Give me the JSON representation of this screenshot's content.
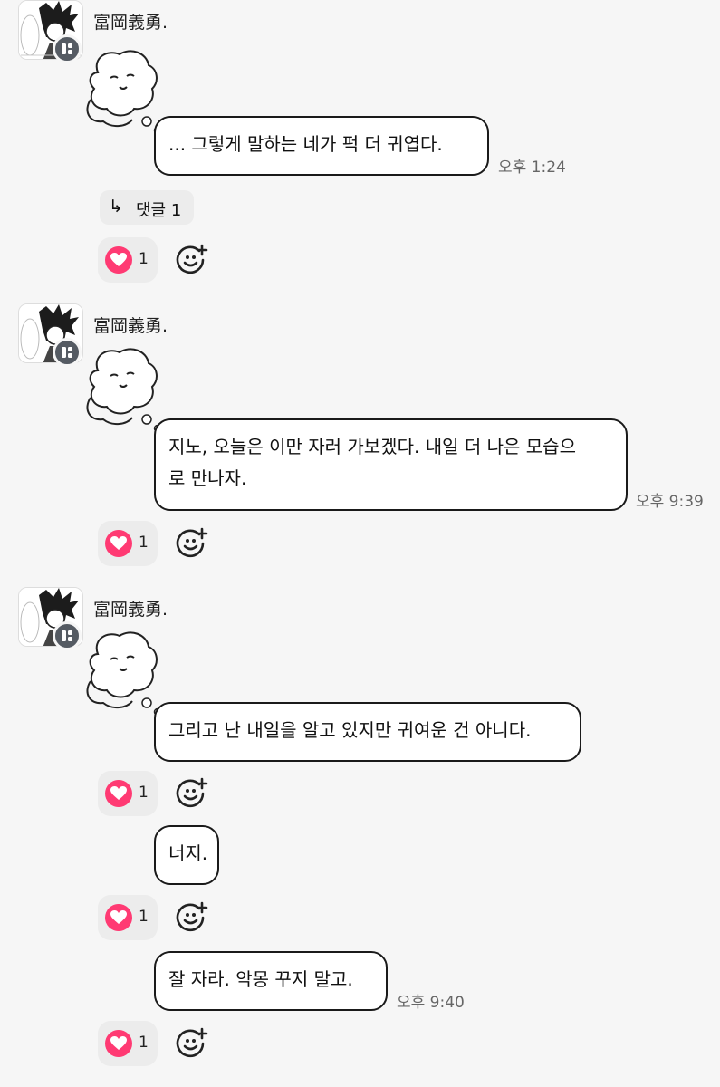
{
  "messages_group_1": {
    "sender": "富岡義勇.",
    "text": "... 그렇게 말하는 네가 퍽 더 귀엽다.",
    "time": "오후 1:24",
    "reply": {
      "label": "댓글",
      "count": "1"
    },
    "reactions": {
      "heart_count": "1"
    }
  },
  "messages_group_2": {
    "sender": "富岡義勇.",
    "line1": "지노, 오늘은 이만 자러 가보겠다. 내일 더 나은 모습으",
    "line2": "로 만나자.",
    "time": "오후 9:39",
    "reactions": {
      "heart_count": "1"
    }
  },
  "messages_group_3": {
    "sender": "富岡義勇.",
    "msg1": {
      "text": "그리고 난 내일을 알고 있지만 귀여운 건 아니다.",
      "heart_count": "1"
    },
    "msg2": {
      "text": "너지.",
      "heart_count": "1"
    },
    "msg3": {
      "text": "잘 자라. 악몽 꾸지 말고.",
      "time": "오후 9:40",
      "heart_count": "1"
    }
  },
  "icons": {
    "heart": "heart-icon",
    "add_reaction": "add-reaction-icon",
    "reply": "reply-arrow-icon",
    "profile_badge": "profile-badge-icon"
  },
  "colors": {
    "heart": "#ff3a73",
    "background": "#f6f6f6",
    "bubble_border": "#1a1a1a",
    "badge": "#555b63"
  }
}
